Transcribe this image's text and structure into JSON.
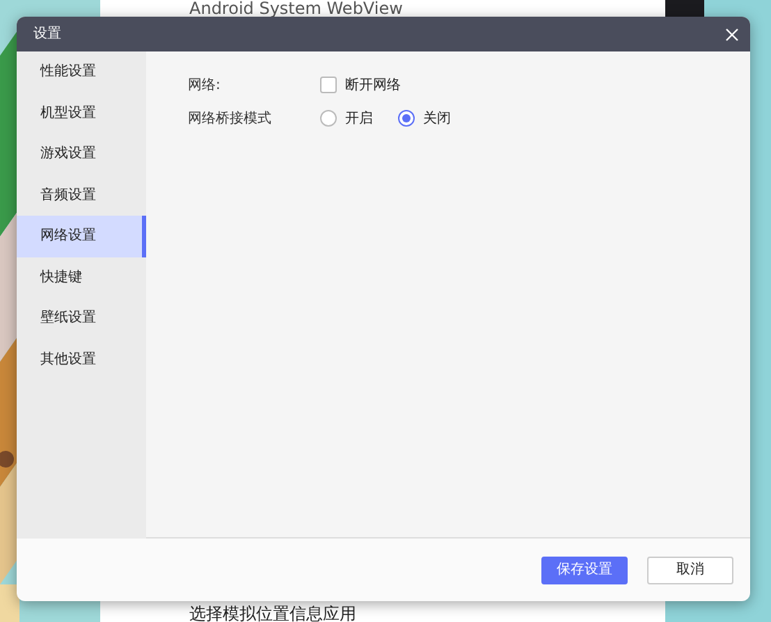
{
  "background": {
    "top_text": "Android System WebView",
    "bottom_text": "选择模拟位置信息应用"
  },
  "dialog": {
    "title": "设置",
    "sidebar": {
      "items": [
        {
          "label": "性能设置",
          "selected": false
        },
        {
          "label": "机型设置",
          "selected": false
        },
        {
          "label": "游戏设置",
          "selected": false
        },
        {
          "label": "音频设置",
          "selected": false
        },
        {
          "label": "网络设置",
          "selected": true
        },
        {
          "label": "快捷键",
          "selected": false
        },
        {
          "label": "壁纸设置",
          "selected": false
        },
        {
          "label": "其他设置",
          "selected": false
        }
      ]
    },
    "settings": [
      {
        "kind": "checkbox",
        "label": "网络:",
        "options": [
          {
            "label": "断开网络",
            "checked": false
          }
        ]
      },
      {
        "kind": "radio",
        "label": "网络桥接模式",
        "options": [
          {
            "label": "开启",
            "selected": false
          },
          {
            "label": "关闭",
            "selected": true
          }
        ]
      }
    ],
    "buttons": [
      {
        "label": "保存设置",
        "kind": "primary"
      },
      {
        "label": "取消",
        "kind": "secondary"
      }
    ]
  }
}
